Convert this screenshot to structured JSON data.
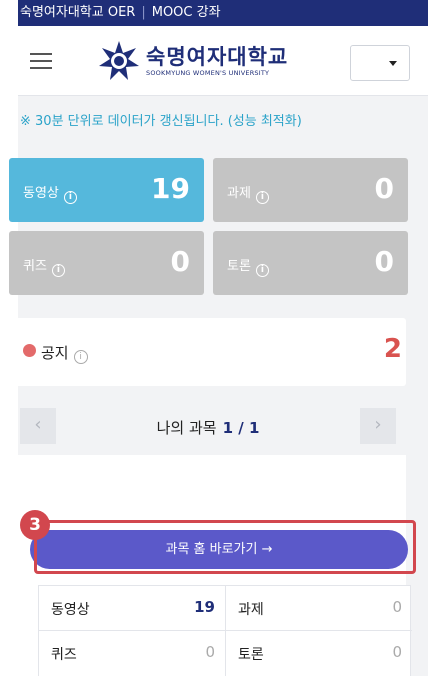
{
  "topbar": {
    "site": "숙명여자대학교 OER",
    "separator": "|",
    "section": "MOOC 강좌"
  },
  "header": {
    "logo_korean": "숙명여자대학교",
    "logo_english": "SOOKMYUNG WOMEN'S UNIVERSITY",
    "menu_icon": "hamburger-icon",
    "select_value": ""
  },
  "notice_text": "※ 30분 단위로 데이터가 갱신됩니다. (성능 최적화)",
  "tiles": [
    {
      "label": "동영상",
      "value": "19",
      "color": "#55b8dc"
    },
    {
      "label": "과제",
      "value": "0",
      "color": "#c4c4c4"
    },
    {
      "label": "퀴즈",
      "value": "0",
      "color": "#c4c4c4"
    },
    {
      "label": "토론",
      "value": "0",
      "color": "#c4c4c4"
    }
  ],
  "info_glyph": "i",
  "announcement": {
    "label": "공지",
    "count": "2",
    "color": "#d9534f"
  },
  "course_nav": {
    "prev": "‹",
    "title": "나의 과목",
    "page": "1 / 1",
    "next": "›"
  },
  "go_button": "과목 홈 바로가기 →",
  "step_marker": "3",
  "stats": [
    {
      "label": "동영상",
      "value": "19"
    },
    {
      "label": "과제",
      "value": "0"
    },
    {
      "label": "퀴즈",
      "value": "0"
    },
    {
      "label": "토론",
      "value": "0"
    }
  ]
}
